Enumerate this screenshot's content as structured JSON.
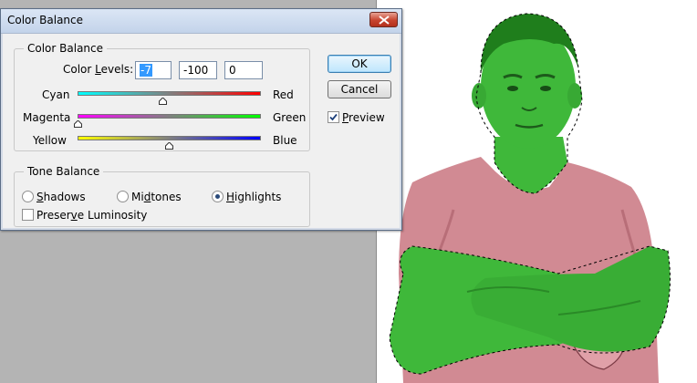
{
  "dialog": {
    "title": "Color Balance",
    "close_icon": "close-icon",
    "color_balance_group": {
      "label": "Color Balance",
      "levels_label_pre": "Color ",
      "levels_label_ul": "L",
      "levels_label_post": "evels:",
      "levels": [
        "-7",
        "-100",
        "0"
      ]
    },
    "sliders": [
      {
        "left": "Cyan",
        "right": "Red",
        "value": -7,
        "min": -100,
        "max": 100,
        "colors": [
          "#00ffff",
          "#ff0000"
        ]
      },
      {
        "left": "Magenta",
        "right": "Green",
        "value": -100,
        "min": -100,
        "max": 100,
        "colors": [
          "#ff00ff",
          "#00ff00"
        ]
      },
      {
        "left": "Yellow",
        "right": "Blue",
        "value": 0,
        "min": -100,
        "max": 100,
        "colors": [
          "#ffff00",
          "#0000ff"
        ]
      }
    ],
    "tone_group": {
      "label": "Tone Balance",
      "shadows": {
        "ul": "S",
        "rest": "hadows"
      },
      "midtones": {
        "pre": "Mi",
        "ul": "d",
        "rest": "tones"
      },
      "highlights": {
        "ul": "H",
        "rest": "ighlights"
      },
      "selected": "highlights",
      "preserve": {
        "pre": "Preser",
        "ul": "v",
        "rest": "e Luminosity"
      },
      "preserve_checked": false
    },
    "buttons": {
      "ok": "OK",
      "cancel": "Cancel"
    },
    "preview": {
      "ul": "P",
      "rest": "review",
      "checked": true
    }
  }
}
